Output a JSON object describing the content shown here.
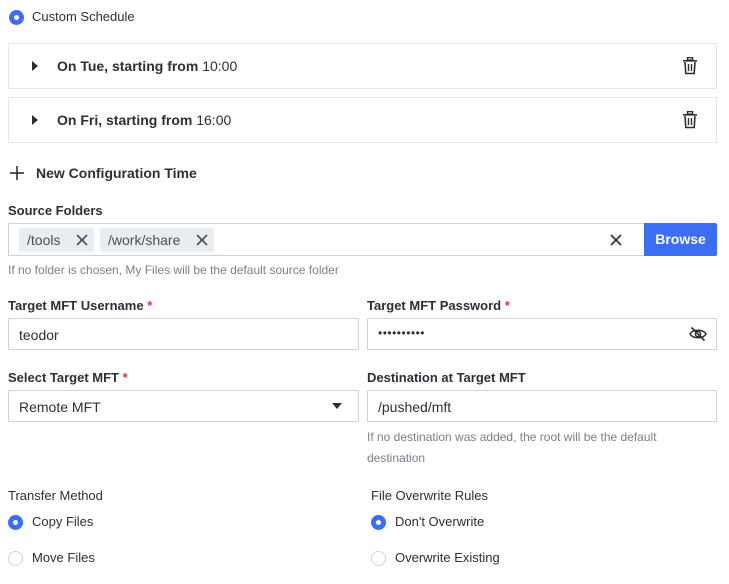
{
  "schedule": {
    "custom_label": "Custom Schedule",
    "entries": [
      {
        "prefix": "On Tue, starting from",
        "time": "10:00"
      },
      {
        "prefix": "On Fri, starting from",
        "time": "16:00"
      }
    ],
    "add_label": "New Configuration Time"
  },
  "source": {
    "label": "Source Folders",
    "chips": [
      "/tools",
      "/work/share"
    ],
    "browse_label": "Browse",
    "hint": "If no folder is chosen, My Files will be the default source folder"
  },
  "username": {
    "label": "Target MFT Username",
    "required_mark": "*",
    "value": "teodor"
  },
  "password": {
    "label": "Target MFT Password",
    "required_mark": "*",
    "value": "••••••••••"
  },
  "target_mft": {
    "label": "Select Target MFT",
    "required_mark": "*",
    "selected": "Remote MFT"
  },
  "destination": {
    "label": "Destination at Target MFT",
    "value": "/pushed/mft",
    "hint_line1": "If no destination was added, the root will be the default",
    "hint_line2": "destination"
  },
  "transfer_method": {
    "label": "Transfer Method",
    "options": [
      "Copy Files",
      "Move Files"
    ],
    "selected_index": 0
  },
  "overwrite": {
    "label": "File Overwrite Rules",
    "options": [
      "Don't Overwrite",
      "Overwrite Existing"
    ],
    "selected_index": 0
  },
  "colors": {
    "accent": "#3b6ef5",
    "required": "#e0363b",
    "border": "#cfd3d9"
  },
  "icons": [
    "radio-icon",
    "caret-right-icon",
    "trash-icon",
    "plus-icon",
    "close-icon",
    "eye-off-icon",
    "caret-down-icon"
  ]
}
